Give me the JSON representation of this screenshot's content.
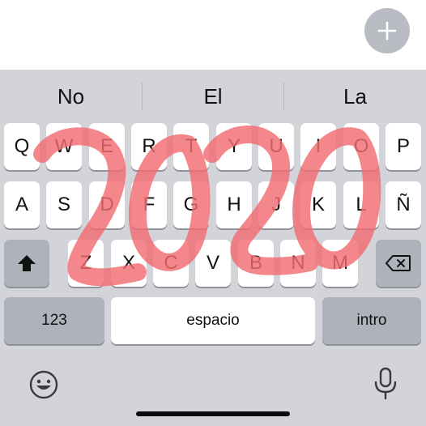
{
  "top": {
    "add_icon": "plus-icon"
  },
  "suggestions": [
    "No",
    "El",
    "La"
  ],
  "rows": {
    "row1": [
      "Q",
      "W",
      "E",
      "R",
      "T",
      "Y",
      "U",
      "I",
      "O",
      "P"
    ],
    "row2": [
      "A",
      "S",
      "D",
      "F",
      "G",
      "H",
      "J",
      "K",
      "L",
      "Ñ"
    ],
    "row3": [
      "Z",
      "X",
      "C",
      "V",
      "B",
      "N",
      "M"
    ]
  },
  "bottom_row": {
    "numbers_label": "123",
    "space_label": "espacio",
    "return_label": "intro"
  },
  "icons": {
    "shift": "shift-arrow-icon",
    "delete": "backspace-icon",
    "emoji": "emoji-smiley-icon",
    "mic": "microphone-icon"
  },
  "drawing": {
    "text": "2020",
    "color": "#f16d73"
  },
  "colors": {
    "keyboard_bg": "#d2d4da",
    "key_bg": "#ffffff",
    "special_key_bg": "#aeb2bb",
    "add_button_bg": "#b9bcc3"
  }
}
